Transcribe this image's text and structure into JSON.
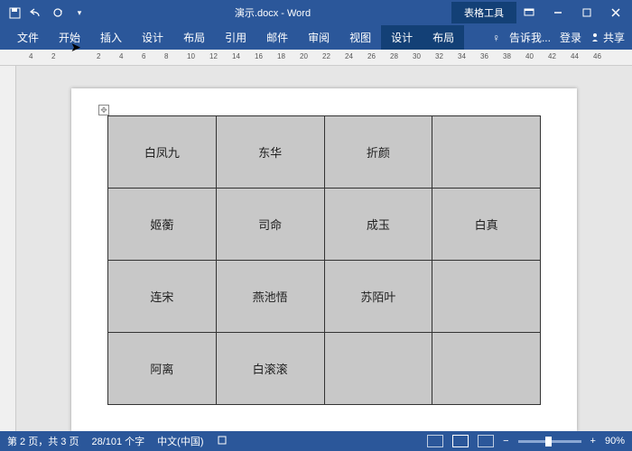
{
  "titlebar": {
    "doc_title": "演示.docx - Word",
    "table_tools": "表格工具"
  },
  "ribbon": {
    "tabs": [
      "文件",
      "开始",
      "插入",
      "设计",
      "布局",
      "引用",
      "邮件",
      "审阅",
      "视图"
    ],
    "context_tabs": [
      "设计",
      "布局"
    ],
    "tell_me": "告诉我...",
    "login": "登录",
    "share": "共享"
  },
  "ruler_ticks": [
    "4",
    "2",
    "",
    "2",
    "4",
    "6",
    "8",
    "10",
    "12",
    "14",
    "16",
    "18",
    "20",
    "22",
    "24",
    "26",
    "28",
    "30",
    "32",
    "34",
    "36",
    "38",
    "40",
    "42",
    "44",
    "46"
  ],
  "table": {
    "rows": [
      [
        "白凤九",
        "东华",
        "折颜",
        ""
      ],
      [
        "姬蘅",
        "司命",
        "成玉",
        "白真"
      ],
      [
        "连宋",
        "燕池悟",
        "苏陌叶",
        ""
      ],
      [
        "阿离",
        "白滚滚",
        "",
        ""
      ]
    ]
  },
  "statusbar": {
    "page": "第 2 页，共 3 页",
    "words": "28/101 个字",
    "lang": "中文(中国)",
    "zoom": "90%"
  }
}
